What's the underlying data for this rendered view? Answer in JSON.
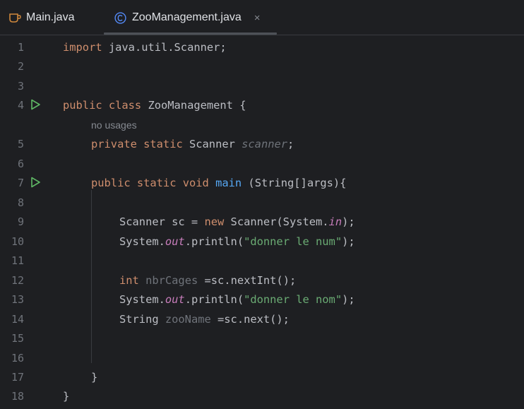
{
  "tabs": [
    {
      "label": "Main.java",
      "icon": "java-cup-icon",
      "active": false
    },
    {
      "label": "ZooManagement.java",
      "icon": "java-class-icon",
      "active": true,
      "close": "×"
    }
  ],
  "colors": {
    "background": "#1e1f22",
    "keyword": "#cf8e6d",
    "method": "#56a8f5",
    "string": "#6aab73",
    "static_field": "#c77dbb",
    "unused": "#6f737a",
    "run_gutter": "#5fb865"
  },
  "gutter": {
    "line_numbers": [
      "1",
      "2",
      "3",
      "4",
      "5",
      "6",
      "7",
      "8",
      "9",
      "10",
      "11",
      "12",
      "13",
      "14",
      "15",
      "16",
      "17",
      "18"
    ],
    "run_markers_on_lines": [
      4,
      7
    ]
  },
  "code": {
    "l1": {
      "kw": "import",
      "rest": " java.util.Scanner;"
    },
    "l4": {
      "kw": "public class",
      "rest": " ZooManagement {"
    },
    "hint": "no usages",
    "l5": {
      "kw": "private static",
      "type": " Scanner ",
      "field": "scanner",
      "end": ";"
    },
    "l7": {
      "kw": "public static void",
      "sp": " ",
      "method": "main",
      "rest": " (String[]args){"
    },
    "l9": {
      "a": "Scanner sc = ",
      "kw": "new",
      "b": " Scanner(System.",
      "st": "in",
      "c": ");"
    },
    "l10": {
      "a": "System.",
      "st": "out",
      "b": ".println(",
      "str": "\"donner le num\"",
      "c": ");"
    },
    "l12": {
      "kw": "int",
      "sp": " ",
      "var": "nbrCages",
      "rest": " =sc.nextInt();"
    },
    "l13": {
      "a": "System.",
      "st": "out",
      "b": ".println(",
      "str": "\"donner le nom\"",
      "c": ");"
    },
    "l14": {
      "a": "String ",
      "var": "zooName",
      "rest": " =sc.next();"
    },
    "l17": "}",
    "l18": "}"
  }
}
